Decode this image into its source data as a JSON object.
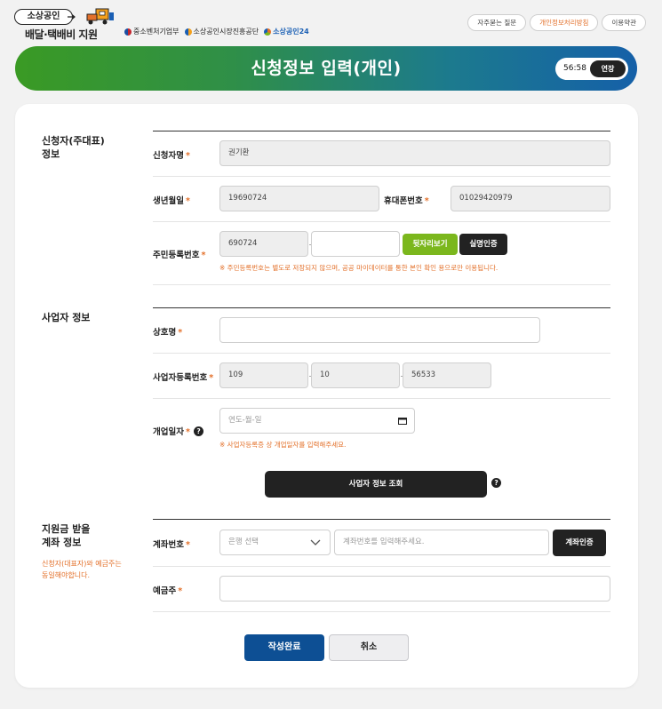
{
  "brand": {
    "pill_text": "소상공인",
    "subtitle": "배달·택배비 지원",
    "orgs": [
      "중소벤처기업부",
      "소상공인시장진흥공단",
      "소상공인24"
    ]
  },
  "top_links": [
    "자주묻는 질문",
    "개인정보처리방침",
    "이용약관"
  ],
  "banner": {
    "title": "신청정보 입력(개인)",
    "timer": "56:58",
    "extend_label": "연장"
  },
  "sections": {
    "applicant": {
      "title_line1": "신청자(주대표)",
      "title_line2": "정보",
      "name_label": "신청자명",
      "name_value": "권기환",
      "birth_label": "생년월일",
      "birth_value": "19690724",
      "phone_label": "휴대폰번호",
      "phone_value": "01029420979",
      "rrn_label": "주민등록번호",
      "rrn_front": "690724",
      "rrn_back": "",
      "reveal_btn": "뒷자리보기",
      "verify_btn": "실명인증",
      "rrn_hint": "※ 주민등록번호는 별도로 저장되지 않으며, 공공 마이데이터를 통한 본인 확인 용으로만 이용됩니다."
    },
    "business": {
      "title": "사업자 정보",
      "company_label": "상호명",
      "company_value": "",
      "brn_label": "사업자등록번호",
      "brn_1": "109",
      "brn_2": "10",
      "brn_3": "56533",
      "open_label": "개업일자",
      "open_placeholder": "연도-월-일",
      "open_hint": "※ 사업자등록증 상 개업일자를 입력해주세요.",
      "lookup_btn": "사업자 정보 조회"
    },
    "account": {
      "title_line1": "지원금 받을",
      "title_line2": "계좌 정보",
      "note_line1": "신청자(대표자)와 예금주는",
      "note_line2": "동일해야합니다.",
      "account_label": "계좌번호",
      "bank_placeholder": "은행 선택",
      "account_placeholder": "계좌번호를 입력해주세요.",
      "verify_btn": "계좌인증",
      "holder_label": "예금주",
      "holder_value": ""
    }
  },
  "actions": {
    "submit": "작성완료",
    "cancel": "취소"
  },
  "required_mark": "*",
  "help_mark": "?",
  "colors": {
    "accent_orange": "#e3702a",
    "green_button": "#7bb71d",
    "primary_blue": "#0d4f94",
    "banner_start": "#3a9a24",
    "banner_end": "#1560a8"
  }
}
